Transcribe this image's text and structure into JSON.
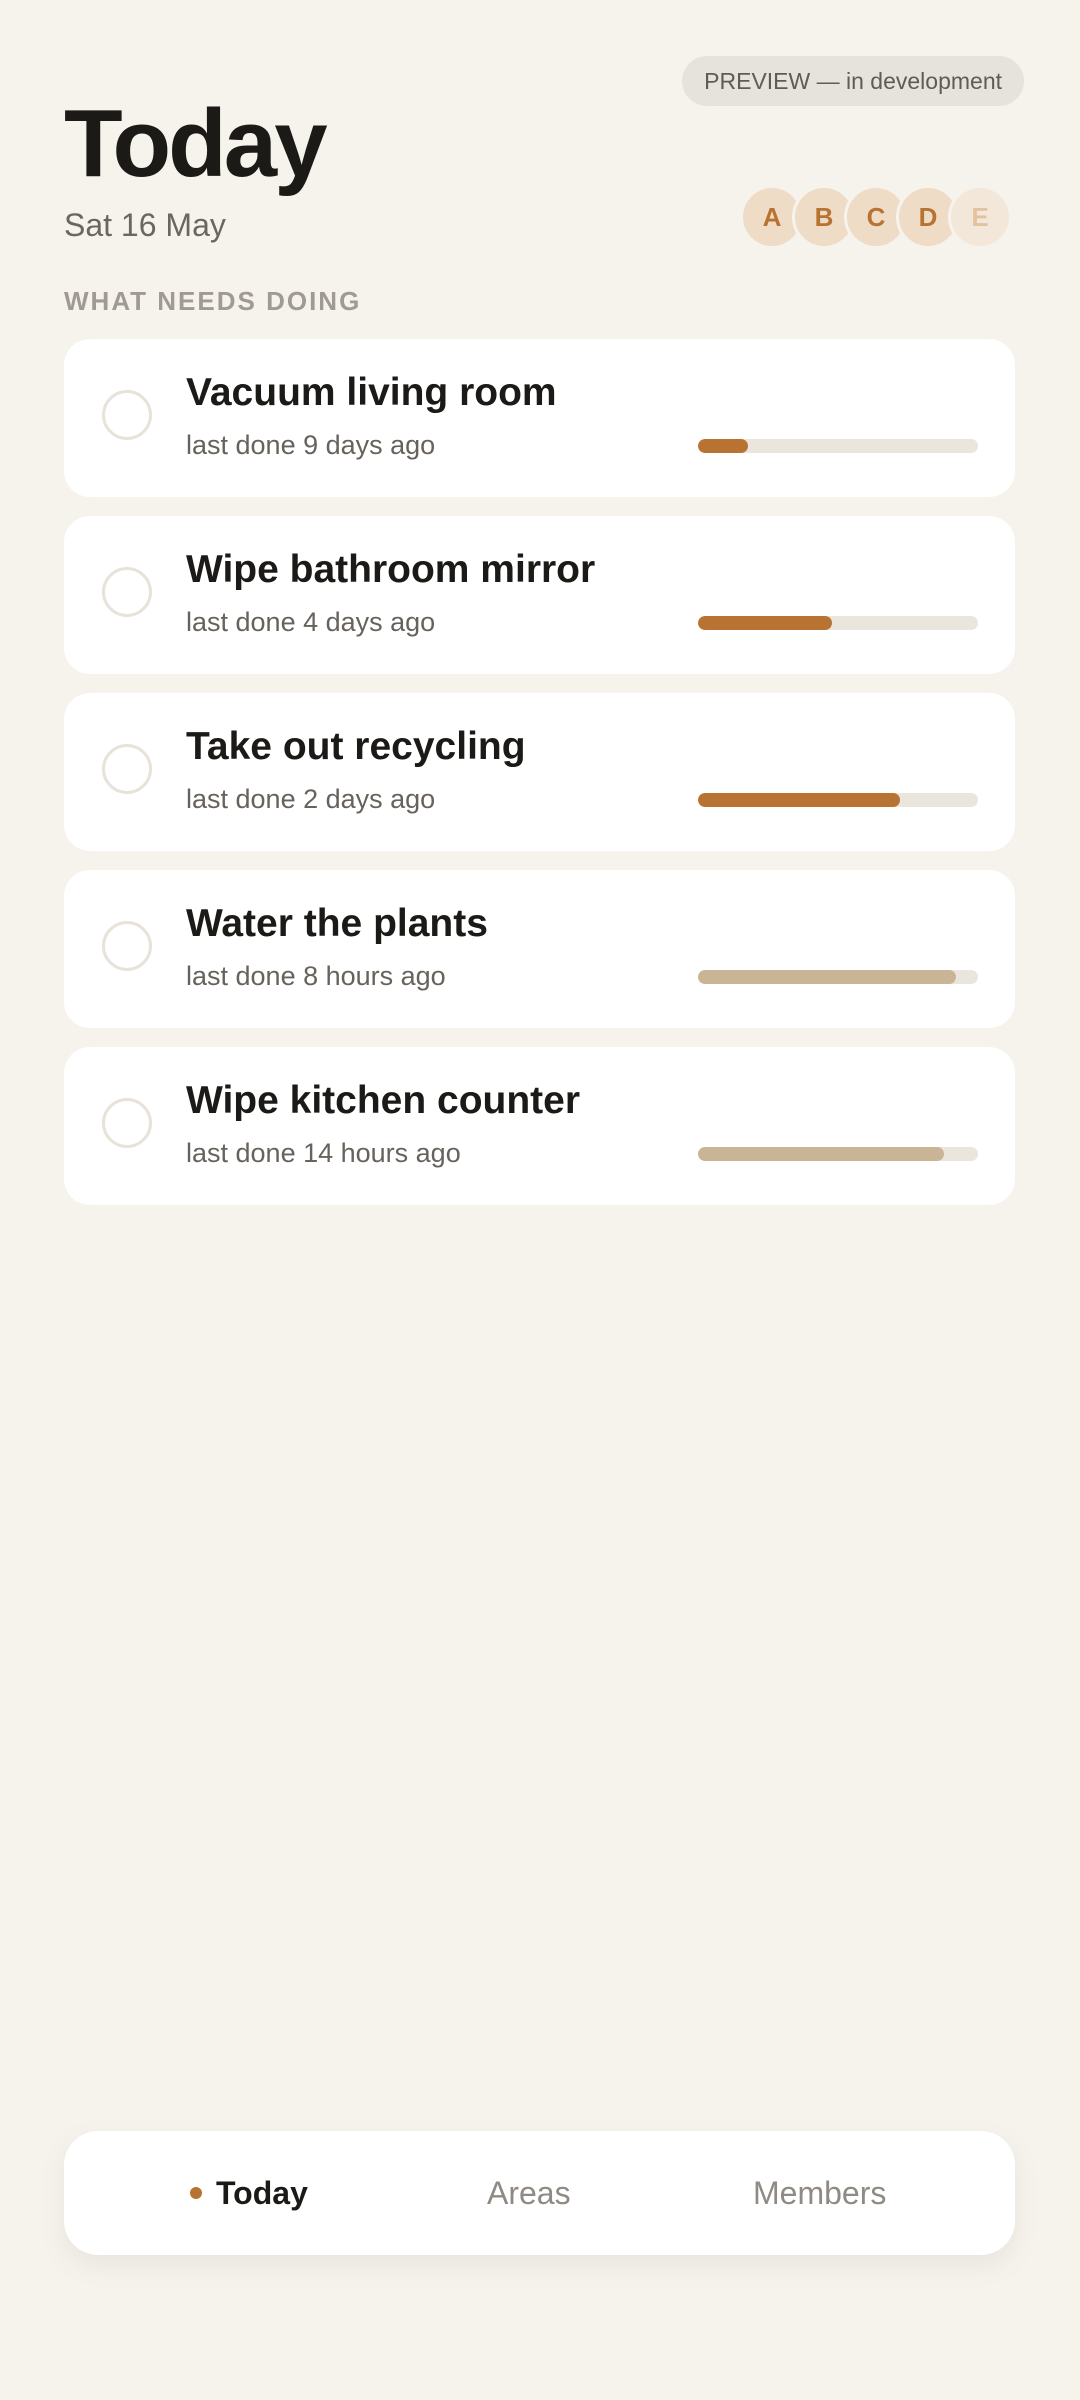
{
  "header": {
    "preview_label": "PREVIEW — in development",
    "title": "Today",
    "date": "Sat 16 May"
  },
  "members": [
    {
      "initial": "A"
    },
    {
      "initial": "B"
    },
    {
      "initial": "C"
    },
    {
      "initial": "D"
    },
    {
      "initial": "E",
      "faded": true
    }
  ],
  "section_label": "WHAT NEEDS DOING",
  "tasks": [
    {
      "title": "Vacuum living room",
      "last_done": "last done 9 days ago",
      "progress": 0.18,
      "bar_color": "#b87333"
    },
    {
      "title": "Wipe bathroom mirror",
      "last_done": "last done 4 days ago",
      "progress": 0.48,
      "bar_color": "#b87333"
    },
    {
      "title": "Take out recycling",
      "last_done": "last done 2 days ago",
      "progress": 0.72,
      "bar_color": "#b87333"
    },
    {
      "title": "Water the plants",
      "last_done": "last done 8 hours ago",
      "progress": 0.92,
      "bar_color": "#c9b596"
    },
    {
      "title": "Wipe kitchen counter",
      "last_done": "last done 14 hours ago",
      "progress": 0.88,
      "bar_color": "#c9b596"
    }
  ],
  "nav": {
    "today": "Today",
    "areas": "Areas",
    "members": "Members",
    "active": "today"
  },
  "colors": {
    "background": "#f6f3ed",
    "accent": "#b87333",
    "avatar_bg": "#efdcc7",
    "bar_track": "#ebe6dd",
    "bar_fresh": "#c9b596"
  }
}
